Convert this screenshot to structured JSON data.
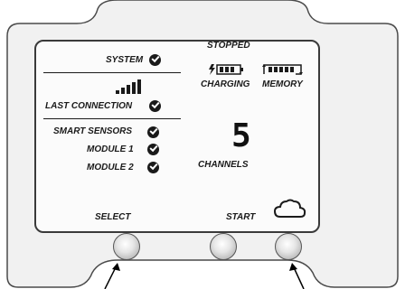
{
  "status": {
    "state": "STOPPED"
  },
  "left_panel": {
    "system_label": "SYSTEM",
    "last_connection_label": "LAST CONNECTION",
    "smart_sensors_label": "SMART SENSORS",
    "module1_label": "MODULE 1",
    "module2_label": "MODULE 2"
  },
  "right_panel": {
    "charging_label": "CHARGING",
    "memory_label": "MEMORY",
    "channels_count": "5",
    "channels_label": "CHANNELS"
  },
  "buttons": {
    "select_label": "SELECT",
    "start_label": "START"
  },
  "icons": {
    "status_ok": "check-circle-icon",
    "signal": "signal-strength-icon",
    "battery": "battery-charging-icon",
    "memory": "memory-icon",
    "cloud": "cloud-icon"
  }
}
